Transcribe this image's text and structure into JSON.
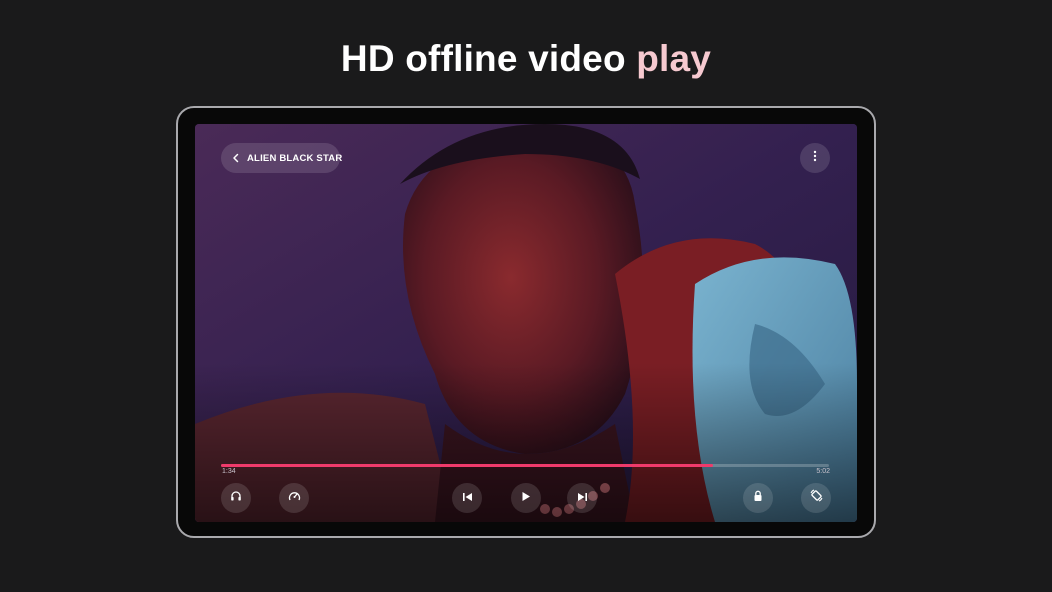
{
  "headline": {
    "main": "HD offline video ",
    "accent": "play"
  },
  "player": {
    "title": "ALIEN BLACK STAR",
    "elapsed": "1:34",
    "duration": "5:02",
    "progress": 0.81,
    "accent_color": "#ef3a6b"
  },
  "icons": {
    "back": "chevron-left-icon",
    "menu": "more-vertical-icon",
    "audio": "headphones-icon",
    "speed": "speed-icon",
    "previous": "skip-previous-icon",
    "play": "play-icon",
    "next": "skip-next-icon",
    "lock": "lock-icon",
    "rotate": "screen-rotation-icon"
  }
}
